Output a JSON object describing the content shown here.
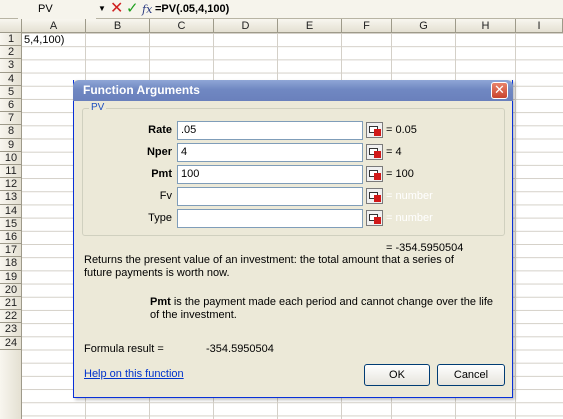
{
  "formula_bar": {
    "name_box": "PV",
    "cancel_glyph": "✕",
    "enter_glyph": "✓",
    "fx_label": "fx",
    "formula": "=PV(.05,4,100)"
  },
  "sheet": {
    "columns": [
      "A",
      "B",
      "C",
      "D",
      "E",
      "F",
      "G",
      "H",
      "I"
    ],
    "rows": [
      "1",
      "2",
      "3",
      "4",
      "5",
      "6",
      "7",
      "8",
      "9",
      "10",
      "11",
      "12",
      "13",
      "14",
      "15",
      "16",
      "17",
      "18",
      "19",
      "20",
      "21",
      "22",
      "23",
      "24"
    ],
    "cell_a1": "5,4,100)"
  },
  "dialog": {
    "title": "Function Arguments",
    "close_glyph": "✕",
    "function_name": "PV",
    "arguments": [
      {
        "label": "Rate",
        "required": true,
        "value": ".05",
        "result": "= 0.05"
      },
      {
        "label": "Nper",
        "required": true,
        "value": "4",
        "result": "= 4"
      },
      {
        "label": "Pmt",
        "required": true,
        "value": "100",
        "result": "= 100"
      },
      {
        "label": "Fv",
        "required": false,
        "value": "",
        "result": "= number"
      },
      {
        "label": "Type",
        "required": false,
        "value": "",
        "result": "= number"
      }
    ],
    "total_result": "= -354.5950504",
    "description": "Returns the present value of an investment: the total amount that a series of future payments is worth now.",
    "arg_help_name": "Pmt",
    "arg_help_text": "is the payment made each period and cannot change over the life of the investment.",
    "formula_result_label": "Formula result =",
    "formula_result_value": "-354.5950504",
    "help_link": "Help on this function",
    "ok_label": "OK",
    "cancel_label": "Cancel"
  },
  "icons": {
    "collapse": "collapse-dialog-icon",
    "close": "close-icon"
  },
  "colors": {
    "titlebar": "#7088c2",
    "dialog_bg": "#ece9d8",
    "link": "#0033cc",
    "group_label": "#1c4ec0"
  }
}
